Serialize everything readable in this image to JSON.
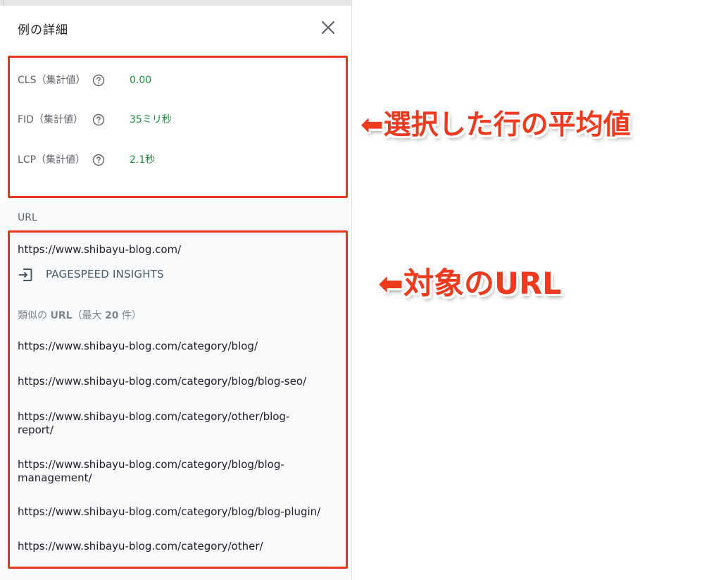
{
  "panel": {
    "title": "例の詳細",
    "close_icon": "close-icon"
  },
  "metrics": [
    {
      "label": "CLS（集計値）",
      "value": "0.00",
      "icon": "help-circle-icon"
    },
    {
      "label": "FID（集計値）",
      "value": "35ミリ秒",
      "icon": "help-circle-icon"
    },
    {
      "label": "LCP（集計値）",
      "value": "2.1秒",
      "icon": "help-circle-icon"
    }
  ],
  "url_section": {
    "label": "URL",
    "main_url": "https://www.shibayu-blog.com/",
    "psi_link": "PAGESPEED INSIGHTS",
    "psi_icon": "open-external-icon",
    "similar_prefix": "類似の ",
    "similar_url_word": "URL",
    "similar_middle": "（最大 ",
    "similar_count": "20",
    "similar_suffix": " 件）",
    "similar_urls": [
      "https://www.shibayu-blog.com/category/blog/",
      "https://www.shibayu-blog.com/category/blog/blog-seo/",
      "https://www.shibayu-blog.com/category/other/blog-report/",
      "https://www.shibayu-blog.com/category/blog/blog-management/",
      "https://www.shibayu-blog.com/category/blog/blog-plugin/",
      "https://www.shibayu-blog.com/category/other/"
    ]
  },
  "annotations": {
    "callout_1": "⬅選択した行の平均値",
    "callout_2": "⬅対象のURL",
    "color": "#e8361d"
  },
  "colors": {
    "good_value": "#1e8e3e",
    "panel_bg": "#f8f9fa"
  }
}
